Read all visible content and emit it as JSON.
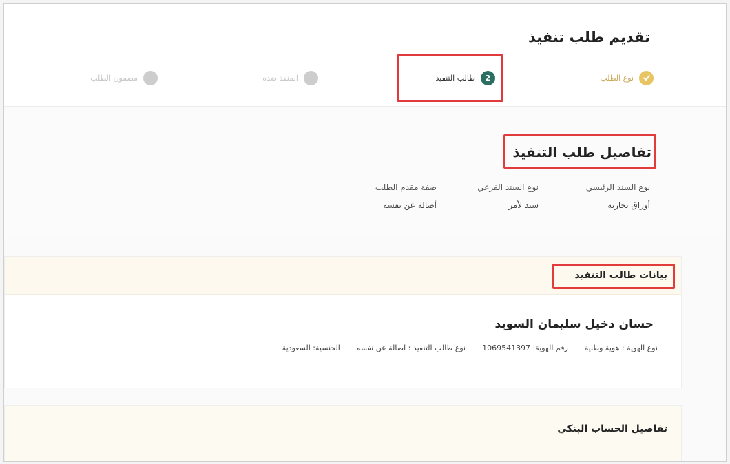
{
  "page": {
    "title": "تقديم طلب تنفيذ"
  },
  "stepper": {
    "steps": [
      {
        "number": "",
        "label": "نوع الطلب",
        "state": "done"
      },
      {
        "number": "2",
        "label": "طالب التنفيذ",
        "state": "current"
      },
      {
        "number": "",
        "label": "المنفذ ضده",
        "state": "pending"
      },
      {
        "number": "",
        "label": "مضمون الطلب",
        "state": "pending"
      }
    ]
  },
  "details": {
    "title": "تفاصيل طلب التنفيذ",
    "fields": [
      {
        "key": "نوع السند الرئيسي",
        "value": "أوراق تجارية"
      },
      {
        "key": "نوع السند الفرعي",
        "value": "سند لأمر"
      },
      {
        "key": "صفة مقدم الطلب",
        "value": "أصالة عن نفسه"
      }
    ]
  },
  "applicant": {
    "section_title": "بيانات طالب التنفيذ",
    "name": "حسان دخيل سليمان السويد",
    "meta": [
      "نوع الهوية : هوية وطنية",
      "رقم الهوية: 1069541397",
      "نوع طالب التنفيذ : اصالة عن نفسه",
      "الجنسية: السعودية"
    ]
  },
  "bank": {
    "section_title": "تفاصيل الحساب البنكي"
  },
  "colors": {
    "accent_teal": "#2b6f63",
    "step_done": "#e9c463",
    "highlight_red": "#e23b3b",
    "card_header": "#fdf9ef"
  }
}
